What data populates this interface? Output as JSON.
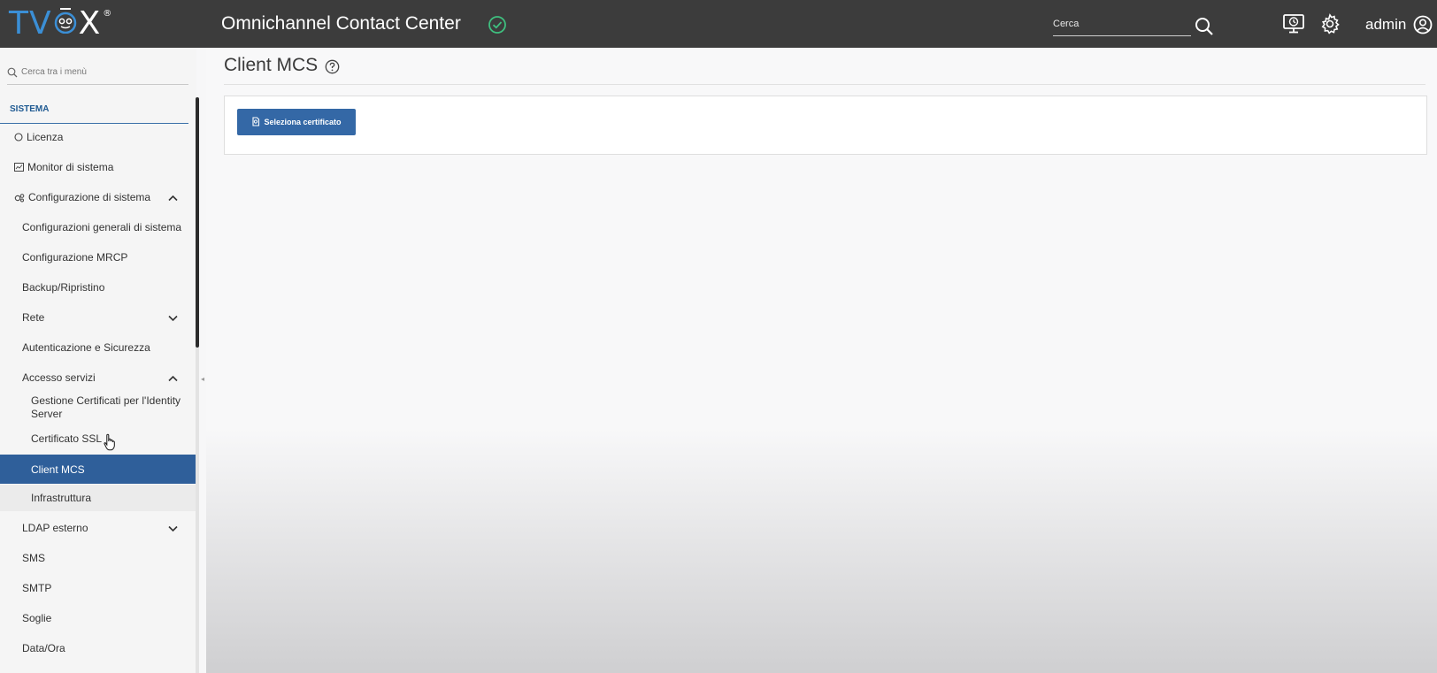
{
  "header": {
    "logo": {
      "part1": "TV",
      "part2": "X",
      "registered": "®"
    },
    "app_title": "Omnichannel Contact Center",
    "search_placeholder": "Cerca",
    "user": "admin",
    "icons": {
      "status": "check-circle-icon",
      "search": "search-icon",
      "monitor": "monitor-clock-icon",
      "settings": "gear-icon",
      "user": "user-circle-icon"
    },
    "colors": {
      "bar": "#3c3c3c",
      "accent": "#3b8fd6",
      "status": "#3fbf7f"
    }
  },
  "sidebar": {
    "search_placeholder": "Cerca tra i menù",
    "section": "SISTEMA",
    "items": [
      {
        "label": "Licenza",
        "icon": "circle-icon"
      },
      {
        "label": "Monitor di sistema",
        "icon": "monitor-chart-icon"
      },
      {
        "label": "Configurazione di sistema",
        "icon": "gears-icon",
        "expanded": true
      },
      {
        "label": "Configurazioni generali di sistema"
      },
      {
        "label": "Configurazione MRCP"
      },
      {
        "label": "Backup/Ripristino"
      },
      {
        "label": "Rete",
        "expanded": false
      },
      {
        "label": "Autenticazione e Sicurezza"
      },
      {
        "label": "Accesso servizi",
        "expanded": true
      },
      {
        "label": "Gestione Certificati per l'Identity Server"
      },
      {
        "label": "Certificato SSL"
      },
      {
        "label": "Client MCS",
        "active": true
      },
      {
        "label": "Infrastruttura"
      },
      {
        "label": "LDAP esterno",
        "expanded": false
      },
      {
        "label": "SMS"
      },
      {
        "label": "SMTP"
      },
      {
        "label": "Soglie"
      },
      {
        "label": "Data/Ora"
      }
    ],
    "active_color": "#2f5f9a"
  },
  "main": {
    "title": "Client MCS",
    "select_cert_button": "Seleziona certificato",
    "button_color": "#3468a6"
  }
}
